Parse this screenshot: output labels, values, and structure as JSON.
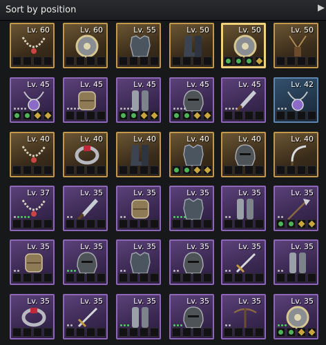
{
  "header": {
    "sort_label": "Sort by position"
  },
  "items": [
    {
      "level": "Lv. 60",
      "rarity": "legendary",
      "icon": "necklace-icon",
      "slots": [
        "e",
        "e",
        "e",
        "e"
      ]
    },
    {
      "level": "Lv. 60",
      "rarity": "legendary",
      "icon": "round-shield-icon",
      "slots": [
        "e",
        "e",
        "e",
        "e"
      ]
    },
    {
      "level": "Lv. 55",
      "rarity": "legendary",
      "icon": "chest-armor-icon",
      "slots": [
        "e",
        "e",
        "e",
        "e"
      ]
    },
    {
      "level": "Lv. 50",
      "rarity": "legendary",
      "icon": "boots-icon",
      "slots": [
        "e",
        "e",
        "e",
        "e"
      ]
    },
    {
      "level": "Lv. 50",
      "rarity": "legendary",
      "icon": "round-shield-icon",
      "slots": [
        "g",
        "g",
        "g",
        "y"
      ],
      "selected": true
    },
    {
      "level": "Lv. 50",
      "rarity": "legendary",
      "icon": "pendant-icon",
      "slots": [
        "e",
        "e",
        "e",
        "e"
      ]
    },
    {
      "level": "Lv. 45",
      "rarity": "epic",
      "icon": "amulet-icon",
      "slots": [
        "g",
        "g",
        "y",
        "y"
      ],
      "dots": "wwww"
    },
    {
      "level": "Lv. 45",
      "rarity": "epic",
      "icon": "bracer-icon",
      "slots": [
        "e",
        "e",
        "e",
        "e"
      ],
      "dots": "wwww"
    },
    {
      "level": "Lv. 45",
      "rarity": "epic",
      "icon": "greaves-icon",
      "slots": [
        "g",
        "g",
        "y",
        "y"
      ],
      "dots": "wwww"
    },
    {
      "level": "Lv. 45",
      "rarity": "epic",
      "icon": "helmet-icon",
      "slots": [
        "g",
        "g",
        "y",
        "y"
      ],
      "dots": "wwww"
    },
    {
      "level": "Lv. 45",
      "rarity": "epic",
      "icon": "dagger-icon",
      "slots": [
        "e",
        "e",
        "e",
        "e"
      ],
      "dots": "wwww"
    },
    {
      "level": "Lv. 42",
      "rarity": "rare",
      "icon": "amulet-icon",
      "slots": [
        "e",
        "e",
        "e",
        "e"
      ],
      "dots": "www"
    },
    {
      "level": "Lv. 40",
      "rarity": "legendary",
      "icon": "necklace-icon",
      "slots": [
        "e",
        "e",
        "e",
        "e"
      ]
    },
    {
      "level": "Lv. 40",
      "rarity": "legendary",
      "icon": "ring-icon",
      "slots": [
        "e",
        "e",
        "e",
        "e"
      ]
    },
    {
      "level": "Lv. 40",
      "rarity": "legendary",
      "icon": "boots-icon",
      "slots": [
        "e",
        "e",
        "e",
        "e"
      ]
    },
    {
      "level": "Lv. 40",
      "rarity": "legendary",
      "icon": "chest-armor-icon",
      "slots": [
        "g",
        "g",
        "y",
        "y"
      ]
    },
    {
      "level": "Lv. 40",
      "rarity": "legendary",
      "icon": "helmet-icon",
      "slots": [
        "e",
        "e",
        "e",
        "e"
      ]
    },
    {
      "level": "Lv. 40",
      "rarity": "legendary",
      "icon": "sickle-icon",
      "slots": [
        "e",
        "e",
        "e",
        "e"
      ]
    },
    {
      "level": "Lv. 37",
      "rarity": "epic",
      "icon": "necklace-icon",
      "slots": [
        "e",
        "e",
        "e",
        "e"
      ],
      "dots": "wgggg"
    },
    {
      "level": "Lv. 35",
      "rarity": "epic",
      "icon": "dagger-icon",
      "slots": [
        "e",
        "e",
        "e",
        "e"
      ],
      "dots": "ww"
    },
    {
      "level": "Lv. 35",
      "rarity": "epic",
      "icon": "bracer-icon",
      "slots": [
        "e",
        "e",
        "e",
        "e"
      ],
      "dots": "ww"
    },
    {
      "level": "Lv. 35",
      "rarity": "epic",
      "icon": "chest-armor-icon",
      "slots": [
        "e",
        "e",
        "e",
        "e"
      ],
      "dots": "gggg"
    },
    {
      "level": "Lv. 35",
      "rarity": "epic",
      "icon": "greaves-icon",
      "slots": [
        "e",
        "e",
        "e",
        "e"
      ],
      "dots": "ww"
    },
    {
      "level": "Lv. 35",
      "rarity": "epic",
      "icon": "spear-icon",
      "slots": [
        "g",
        "g",
        "y",
        "y"
      ],
      "dots": "ww"
    },
    {
      "level": "Lv. 35",
      "rarity": "epic",
      "icon": "bracer-icon",
      "slots": [
        "e",
        "e",
        "e",
        "e"
      ],
      "dots": "ww"
    },
    {
      "level": "Lv. 35",
      "rarity": "epic",
      "icon": "helmet-icon",
      "slots": [
        "e",
        "e",
        "e",
        "e"
      ],
      "dots": "ggg"
    },
    {
      "level": "Lv. 35",
      "rarity": "epic",
      "icon": "chest-armor-icon",
      "slots": [
        "e",
        "e",
        "e",
        "e"
      ],
      "dots": "ww"
    },
    {
      "level": "Lv. 35",
      "rarity": "epic",
      "icon": "helmet-icon",
      "slots": [
        "e",
        "e",
        "e",
        "e"
      ],
      "dots": "ww"
    },
    {
      "level": "Lv. 35",
      "rarity": "epic",
      "icon": "sword-icon",
      "slots": [
        "e",
        "e",
        "e",
        "e"
      ],
      "dots": "ww"
    },
    {
      "level": "Lv. 35",
      "rarity": "epic",
      "icon": "greaves-icon",
      "slots": [
        "e",
        "e",
        "e",
        "e"
      ],
      "dots": "ww"
    },
    {
      "level": "Lv. 35",
      "rarity": "epic",
      "icon": "ring-icon",
      "slots": [
        "e",
        "e",
        "e",
        "e"
      ],
      "dots": ""
    },
    {
      "level": "Lv. 35",
      "rarity": "epic",
      "icon": "sword-icon",
      "slots": [
        "e",
        "e",
        "e",
        "e"
      ],
      "dots": "ww"
    },
    {
      "level": "Lv. 35",
      "rarity": "epic",
      "icon": "greaves-icon",
      "slots": [
        "e",
        "e",
        "e",
        "e"
      ],
      "dots": "ggg"
    },
    {
      "level": "Lv. 35",
      "rarity": "epic",
      "icon": "helmet-icon",
      "slots": [
        "e",
        "e",
        "e",
        "e"
      ],
      "dots": "ggg"
    },
    {
      "level": "Lv. 35",
      "rarity": "epic",
      "icon": "crossbow-icon",
      "slots": [
        "e",
        "e",
        "e",
        "e"
      ],
      "dots": "ww"
    },
    {
      "level": "Lv. 35",
      "rarity": "epic",
      "icon": "round-shield-icon",
      "slots": [
        "g",
        "g",
        "y",
        "y"
      ],
      "dots": "ggg"
    }
  ]
}
